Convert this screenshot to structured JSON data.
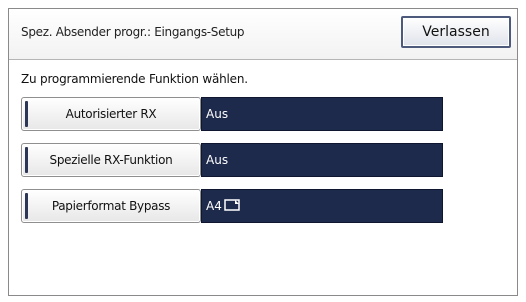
{
  "header": {
    "title": "Spez. Absender progr.: Eingangs-Setup",
    "exit_label": "Verlassen"
  },
  "instruction": "Zu programmierende Funktion wählen.",
  "rows": [
    {
      "label": "Autorisierter RX",
      "value": "Aus"
    },
    {
      "label": "Spezielle RX-Funktion",
      "value": "Aus"
    },
    {
      "label": "Papierformat Bypass",
      "value": "A4",
      "value_icon": "paper-landscape-icon"
    }
  ],
  "colors": {
    "value_background": "#1e2a4b",
    "button_border": "#4d5a7c"
  }
}
